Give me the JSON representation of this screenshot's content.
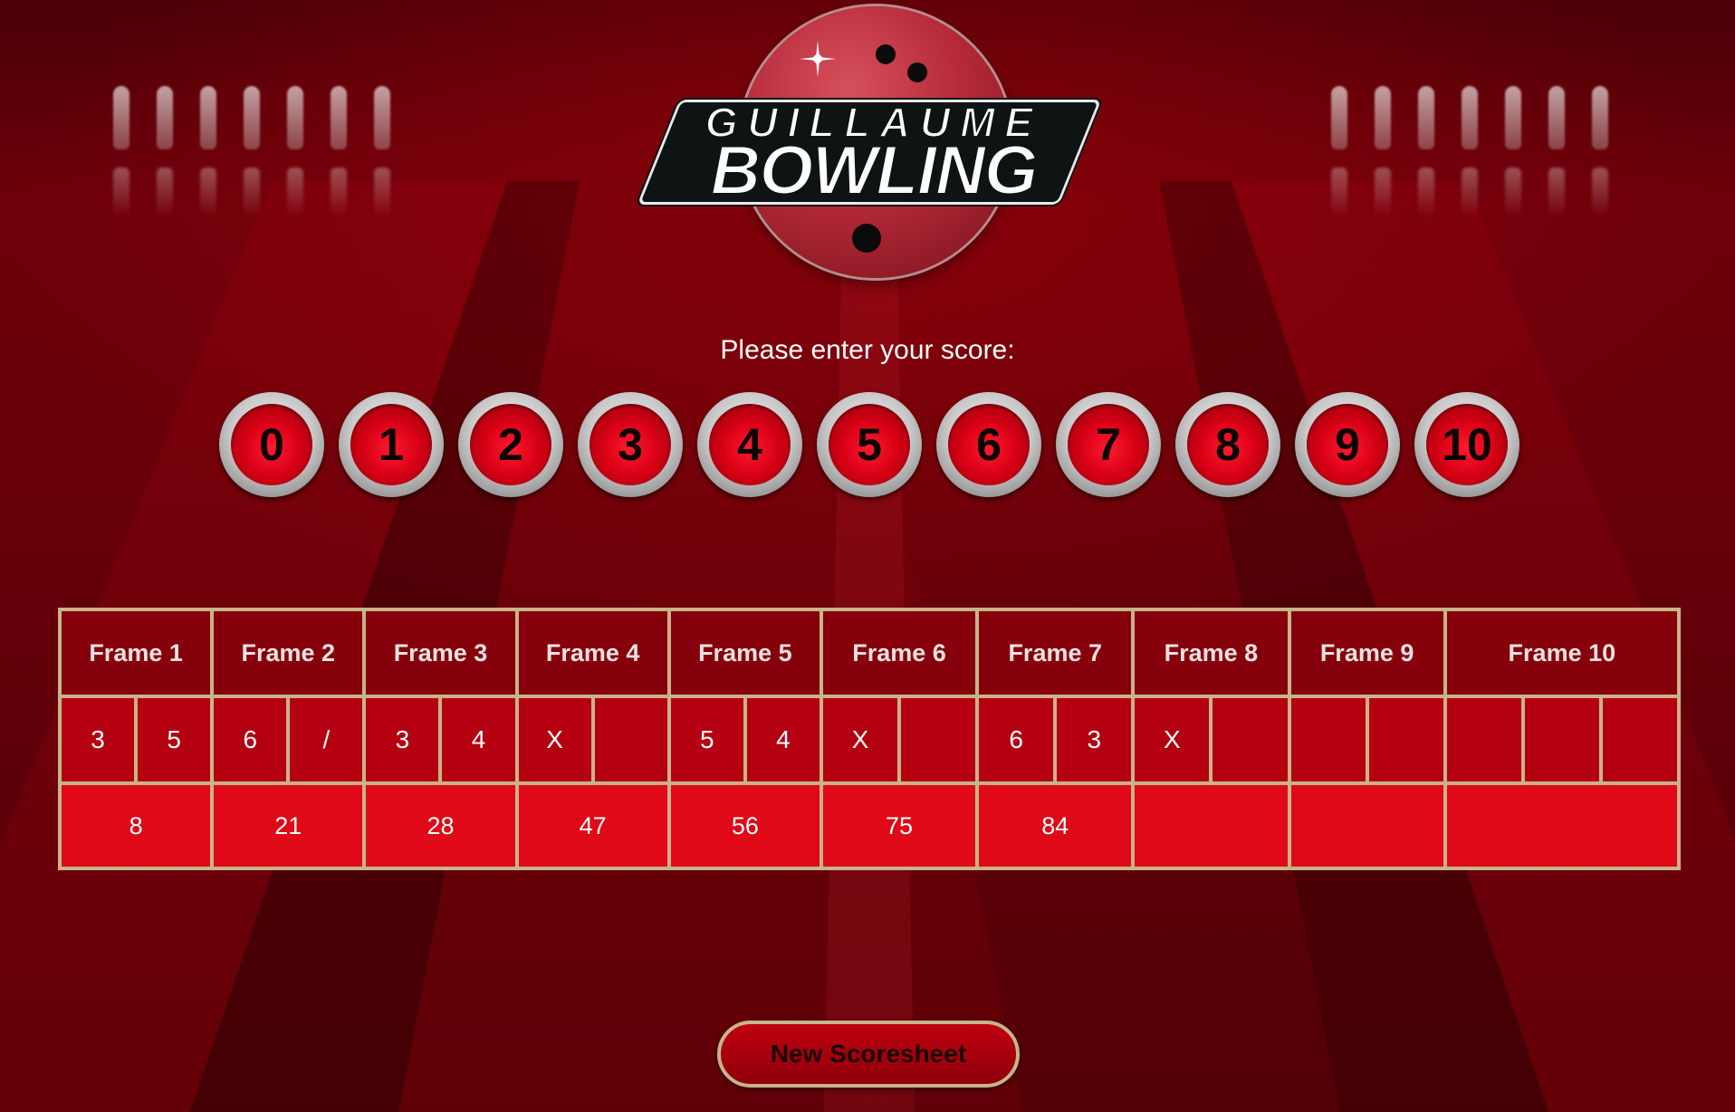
{
  "logo": {
    "line1": "GUILLAUME",
    "line2": "BOWLING"
  },
  "prompt": "Please enter your score:",
  "score_buttons": [
    "0",
    "1",
    "2",
    "3",
    "4",
    "5",
    "6",
    "7",
    "8",
    "9",
    "10"
  ],
  "frames": [
    {
      "label": "Frame 1",
      "rolls": [
        "3",
        "5"
      ],
      "total": "8"
    },
    {
      "label": "Frame 2",
      "rolls": [
        "6",
        "/"
      ],
      "total": "21"
    },
    {
      "label": "Frame 3",
      "rolls": [
        "3",
        "4"
      ],
      "total": "28"
    },
    {
      "label": "Frame 4",
      "rolls": [
        "X",
        ""
      ],
      "total": "47"
    },
    {
      "label": "Frame 5",
      "rolls": [
        "5",
        "4"
      ],
      "total": "56"
    },
    {
      "label": "Frame 6",
      "rolls": [
        "X",
        ""
      ],
      "total": "75"
    },
    {
      "label": "Frame 7",
      "rolls": [
        "6",
        "3"
      ],
      "total": "84"
    },
    {
      "label": "Frame 8",
      "rolls": [
        "X",
        ""
      ],
      "total": ""
    },
    {
      "label": "Frame 9",
      "rolls": [
        "",
        ""
      ],
      "total": ""
    },
    {
      "label": "Frame 10",
      "rolls": [
        "",
        "",
        ""
      ],
      "total": ""
    }
  ],
  "new_button": "New Scoresheet",
  "colors": {
    "background": "#640009",
    "frame_border": "#c8b48a",
    "header_cell": "#85000b",
    "roll_cell": "#b40010",
    "total_cell": "#e00917",
    "button_red": "#d80016"
  }
}
